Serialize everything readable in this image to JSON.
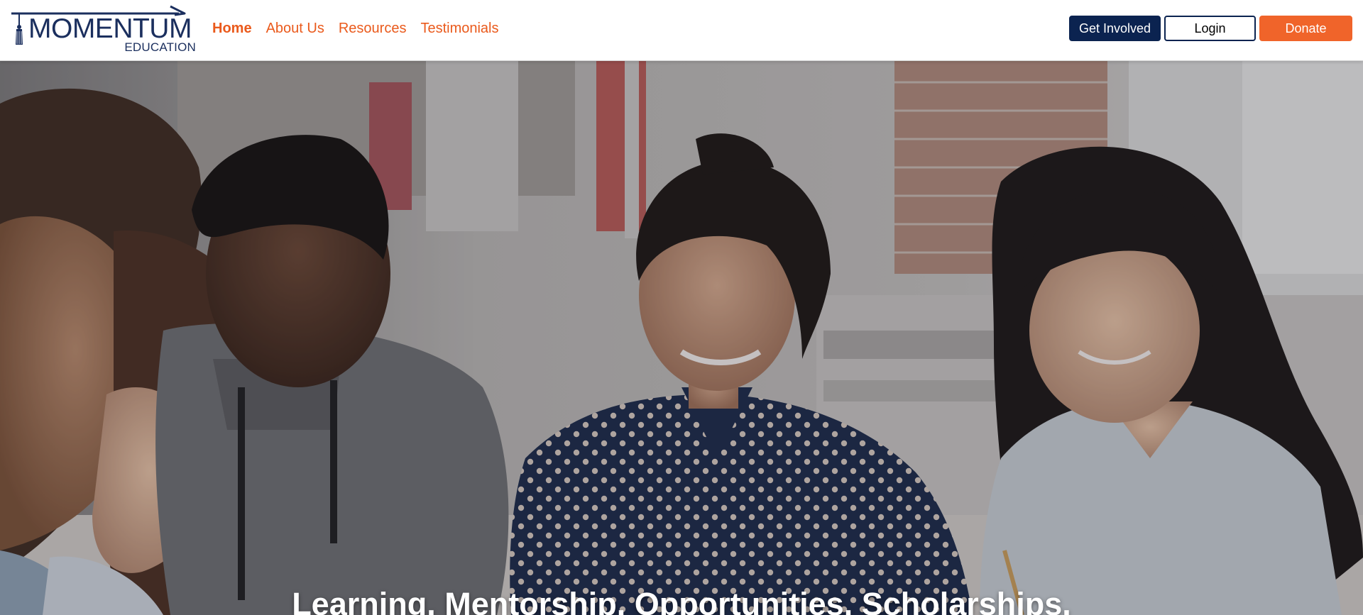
{
  "brand": {
    "name": "MOMENTUM",
    "subtitle": "EDUCATION",
    "icon": "graduation-tassel-icon",
    "color": "#1b2f5e"
  },
  "nav": {
    "items": [
      {
        "label": "Home",
        "active": true
      },
      {
        "label": "About Us",
        "active": false
      },
      {
        "label": "Resources",
        "active": false
      },
      {
        "label": "Testimonials",
        "active": false
      }
    ],
    "color": "#ea5a1c"
  },
  "actions": {
    "get_involved": "Get Involved",
    "login": "Login",
    "donate": "Donate",
    "primary_color": "#0b2350",
    "donate_color": "#f0642a"
  },
  "hero": {
    "image": "students-studying-together-photo",
    "caption": "Learning. Mentorship. Opportunities. Scholarships."
  }
}
